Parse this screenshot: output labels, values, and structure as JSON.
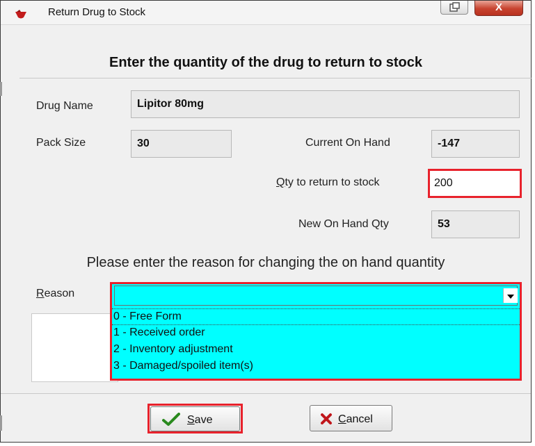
{
  "window": {
    "title": "Return Drug to Stock",
    "close_symbol": "X"
  },
  "heading": "Enter the quantity of the drug to return to stock",
  "fields": {
    "drug_name_label": "Drug Name",
    "drug_name_value": "Lipitor 80mg",
    "pack_size_label": "Pack Size",
    "pack_size_value": "30",
    "current_on_hand_label": "Current On Hand",
    "current_on_hand_value": "-147",
    "qty_return_label_rest": "ty to return to stock",
    "qty_return_label_accel": "Q",
    "qty_return_value": "200",
    "new_on_hand_label": "New On Hand Qty",
    "new_on_hand_value": "53"
  },
  "reason": {
    "instruction": "Please enter the reason for changing the on hand quantity",
    "label_accel": "R",
    "label_rest": "eason",
    "selected": "",
    "options": [
      "0 - Free Form",
      "1 - Received order",
      "2 - Inventory adjustment",
      "3 - Damaged/spoiled item(s)"
    ]
  },
  "buttons": {
    "save_accel": "S",
    "save_rest": "ave",
    "cancel_accel": "C",
    "cancel_rest": "ancel"
  },
  "colors": {
    "highlight_border": "#e8222c",
    "combo_background": "#00ffff",
    "save_check": "#2a8a1e",
    "cancel_x": "#c0161b"
  }
}
